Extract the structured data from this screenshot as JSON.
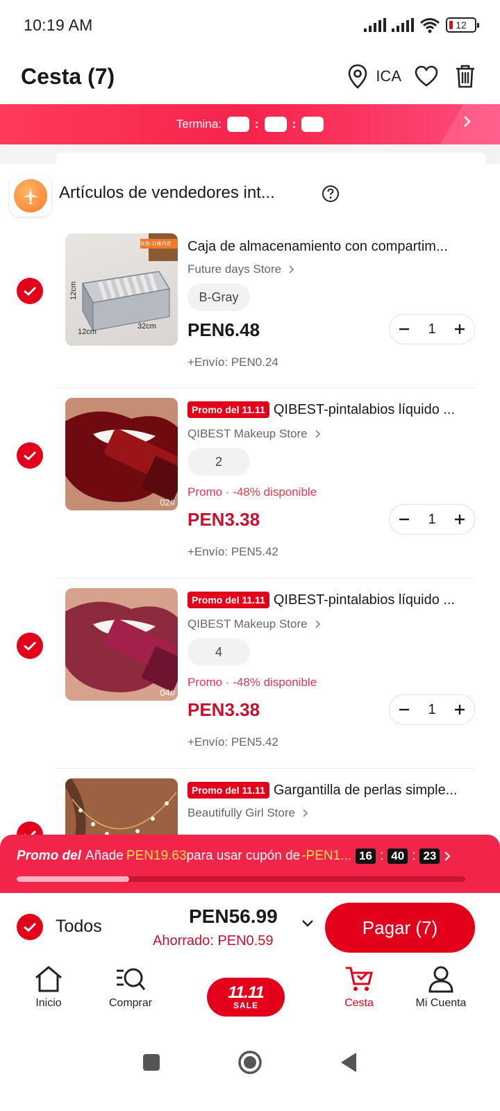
{
  "status_bar": {
    "time": "10:19 AM",
    "battery": "12"
  },
  "header": {
    "title": "Cesta (7)",
    "location": "ICA"
  },
  "promo_banner": {
    "label": "Termina:"
  },
  "seller_section": {
    "title": "Artículos de vendedores int..."
  },
  "items": [
    {
      "title": "Caja de almacenamiento con compartim...",
      "store": "Future days Store",
      "variant": "B-Gray",
      "price": "PEN6.48",
      "shipping": "+Envío: PEN0.24",
      "quantity": "1",
      "thumb_labels": {
        "top": "灰色-11格内衣",
        "h": "12cm",
        "w": "32cm",
        "d": "12cm"
      }
    },
    {
      "promo_tag": "Promo del 11.11",
      "title": "QIBEST-pintalabios líquido ...",
      "store": "QIBEST Makeup Store",
      "variant": "2",
      "promo_note": "Promo · -48% disponible",
      "price": "PEN3.38",
      "shipping": "+Envío: PEN5.42",
      "quantity": "1",
      "thumb_label": "02#"
    },
    {
      "promo_tag": "Promo del 11.11",
      "title": "QIBEST-pintalabios líquido ...",
      "store": "QIBEST Makeup Store",
      "variant": "4",
      "promo_note": "Promo · -48% disponible",
      "price": "PEN3.38",
      "shipping": "+Envío: PEN5.42",
      "quantity": "1",
      "thumb_label": "04#"
    },
    {
      "promo_tag": "Promo del 11.11",
      "title": "Gargantilla de perlas simple...",
      "store": "Beautifully Girl Store"
    }
  ],
  "coupon_bar": {
    "brand": "Promo del",
    "text_before": "Añade",
    "amount": "PEN19.63",
    "text_after": "para usar cupón de",
    "discount": "-PEN1...",
    "countdown": [
      "16",
      "40",
      "23"
    ],
    "progress": 0.25
  },
  "summary": {
    "all_label": "Todos",
    "total": "PEN56.99",
    "saved": "Ahorrado: PEN0.59",
    "pay_label": "Pagar (7)"
  },
  "bottom_nav": {
    "items": [
      {
        "label": "Inicio"
      },
      {
        "label": "Comprar"
      },
      {
        "label": "Cesta"
      },
      {
        "label": "Mi Cuenta"
      }
    ],
    "sale_badge": {
      "big": "11.11",
      "small": "SALE"
    }
  },
  "colors": {
    "accent": "#e3001b",
    "promo_banner": "#f5244c",
    "promo_text": "#e8354c"
  }
}
